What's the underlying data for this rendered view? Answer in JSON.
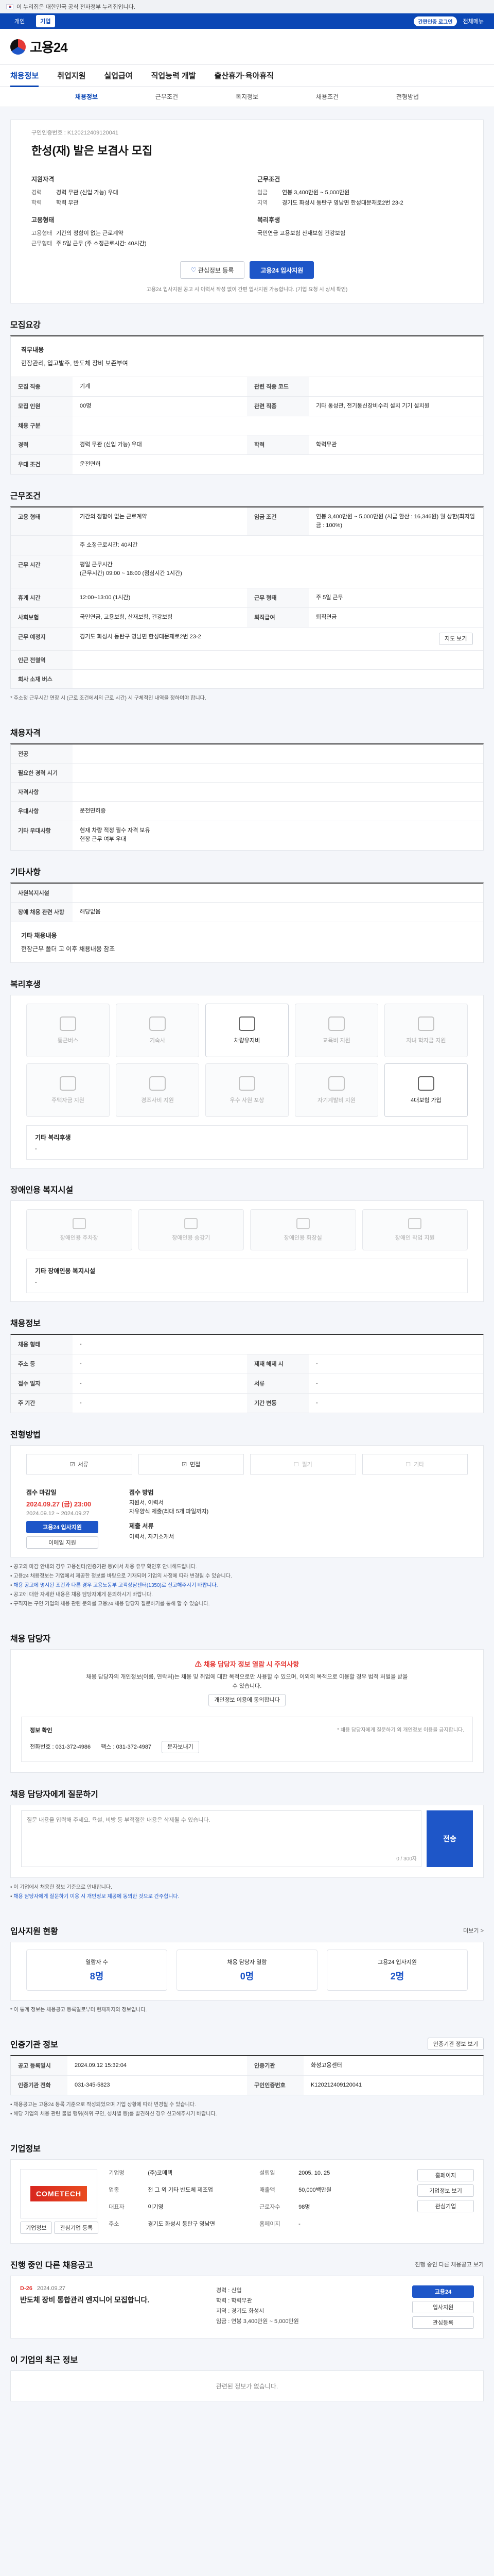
{
  "gov_bar": {
    "text": "이 누리집은 대한민국 공식 전자정부 누리집입니다."
  },
  "util": {
    "tabs": [
      "개인",
      "기업"
    ],
    "login_badge": "간편인증 로그인",
    "menu": "전체메뉴"
  },
  "logo": {
    "text": "고용24"
  },
  "gnb": [
    "채용정보",
    "취업지원",
    "실업급여",
    "직업능력 개발",
    "출산휴가·육아휴직"
  ],
  "subnav": [
    "채용정보",
    "근무조건",
    "복지정보",
    "채용조건",
    "전형방법"
  ],
  "hero": {
    "crumb": "구인인증번호 : K120212409120041",
    "title": "한성(재) 발은 보겸사 모집",
    "left_title": "지원자격",
    "left": [
      {
        "k": "경력",
        "v": "경력 무관 (신입 가능) 우대"
      },
      {
        "k": "학력",
        "v": "학력 무관"
      },
      {
        "k": "",
        "v": ""
      }
    ],
    "right_title": "근무조건",
    "right": [
      {
        "k": "임금",
        "v": "연봉 3,400만원 ~ 5,000만원"
      },
      {
        "k": "지역",
        "v": "경기도 화성시 동탄구 영남면 한성대문재로2번 23-2"
      }
    ],
    "left2_title": "고용형태",
    "left2": [
      {
        "k": "고용형태",
        "v": "기간의 정함이 없는 근로계약"
      },
      {
        "k": "근무형태",
        "v": "주 5일 근무 (주 소정근로시간: 40시간)"
      }
    ],
    "right2_title": "복리후생",
    "right2": [
      {
        "k": "",
        "v": "국민연금 고용보험 산재보험 건강보험"
      }
    ],
    "btn_save": "관심정보 등록",
    "btn_apply": "고용24 입사지원",
    "note": "고용24 입사지원 공고 시 이력서 작성 없이 간편 입사지원 가능합니다. (기업 요청 시 상세 확인)"
  },
  "sections": {
    "recruit": "모집요강",
    "work": "근무조건",
    "apply_cond": "채용자격",
    "other": "기타사항",
    "welfare": "복리후생",
    "disab": "장애인용 복지시설",
    "contract": "채용정보",
    "method": "전형방법",
    "manager": "채용 담당자",
    "inquiry": "채용 담당자에게 질문하기",
    "stats": "입사지원 현황",
    "agency": "인증기관 정보",
    "company": "기업정보",
    "other_jobs": "진행 중인 다른 채용공고",
    "recent": "이 기업의 최근 정보"
  },
  "recruit": {
    "job_title": "직무내용",
    "job_desc": "현장관리, 입고발주, 반도체 장비 보존부여",
    "rows": [
      {
        "k": "모집 직종",
        "v": "기계",
        "k2": "관련 직종 코드",
        "v2": ""
      },
      {
        "k": "모집 인원",
        "v": "00명",
        "k2": "관련 직종",
        "v2": "기타 통성관, 전기통신장비수리 설치 기기 설치원"
      },
      {
        "k": "채용 구분",
        "v": "",
        "k2": "",
        "v2": ""
      },
      {
        "k": "경력",
        "v": "경력 무관 (신입 가능) 우대",
        "k2": "학력",
        "v2": "학력무관"
      },
      {
        "k": "우대 조건",
        "v": "운전면허",
        "k2": "",
        "v2": ""
      }
    ]
  },
  "work": {
    "rows": [
      {
        "k": "고용 형태",
        "v": "기간의 정함이 없는 근로계약",
        "k2": "임금 조건",
        "v2": "연봉 3,400만원 ~ 5,000만원 (시급 환산 : 16,346원) 월 상한(최저임금 : 100%)"
      },
      {
        "k": "",
        "v": "주 소정근로시간: 40시간",
        "k2": "",
        "v2": ""
      },
      {
        "k": "근무 시간",
        "v": "평일 근무시간\n(근무시간) 09:00 ~ 18:00 (점심시간 1시간)",
        "k2": "",
        "v2": ""
      },
      {
        "k": "휴게 시간",
        "v": "12:00~13:00 (1시간)",
        "k2": "근무 형태",
        "v2": "주 5일 근무"
      },
      {
        "k": "사회보험",
        "v": "국민연금, 고용보험, 산재보험, 건강보험",
        "k2": "퇴직급여",
        "v2": "퇴직연금"
      },
      {
        "k": "근무 예정지",
        "v": "경기도 화성시 동탄구 영남면 한성대문재로2번 23-2",
        "k2": "",
        "v2": ""
      },
      {
        "k": "인근 전철역",
        "v": "",
        "k2": "",
        "v2": ""
      },
      {
        "k": "회사 소재 버스",
        "v": "",
        "k2": "",
        "v2": ""
      }
    ],
    "map_btn": "지도 보기",
    "note": "* 주소정 근무시간 연장 시 (근로 조건에서의 근로 시간) 시 구체적인 내역을 정하여야 합니다."
  },
  "apply_cond": {
    "rows": [
      {
        "k": "전공",
        "v": ""
      },
      {
        "k": "필요한 경력 시기",
        "v": ""
      },
      {
        "k": "자격사항",
        "v": ""
      },
      {
        "k": "우대사항",
        "v": "운전면허증"
      },
      {
        "k": "기타 우대사항",
        "v": "현재 차량 적정 필수 자격 보유\n현장 근무 여부 우대"
      }
    ]
  },
  "other": {
    "rows": [
      {
        "k": "사원복지시설",
        "v": ""
      },
      {
        "k": "장애 채용 관련 사항",
        "v": "해당없음"
      }
    ],
    "box_title": "기타 채용내용",
    "box_text": "현장근무 폴더 고 이후 채용내용 참조"
  },
  "welfare": {
    "cards": [
      {
        "label": "통근버스",
        "on": false
      },
      {
        "label": "기숙사",
        "on": false
      },
      {
        "label": "차량유지비",
        "on": true
      },
      {
        "label": "교육비 지원",
        "on": false
      },
      {
        "label": "자녀 학자금 지원",
        "on": false
      },
      {
        "label": "주택자금 지원",
        "on": false
      },
      {
        "label": "경조사비 지원",
        "on": false
      },
      {
        "label": "우수 사원 포상",
        "on": false
      },
      {
        "label": "자기계발비 지원",
        "on": false
      },
      {
        "label": "4대보험 가입",
        "on": true
      }
    ],
    "box_title": "기타 복리후생",
    "box_text": "-"
  },
  "disab": {
    "cards": [
      "장애인용 주차장",
      "장애인용 승강기",
      "장애인용 화장실",
      "장애인 작업 지원"
    ],
    "box_title": "기타 장애인용 복지시설",
    "box_text": "-"
  },
  "contract": {
    "rows": [
      {
        "k": "채용 형태",
        "v": "-",
        "k2": "",
        "v2": ""
      },
      {
        "k": "주소 등",
        "v": "-",
        "k2": "제재 해제 시",
        "v2": "-"
      },
      {
        "k": "접수 일자",
        "v": "-",
        "k2": "서류",
        "v2": "-"
      },
      {
        "k": "주 기간",
        "v": "-",
        "k2": "기간 변동",
        "v2": "-"
      }
    ]
  },
  "method": {
    "items": [
      {
        "label": "서류",
        "on": true
      },
      {
        "label": "면접",
        "on": true
      },
      {
        "label": "필기",
        "on": false
      },
      {
        "label": "기타",
        "on": false
      }
    ],
    "deadline_title": "접수 마감일",
    "deadline": "2024.09.27 (금) 23:00",
    "deadline_sub": "2024.09.12 ~ 2024.09.27",
    "apply_btn": "고용24 입사지원",
    "apply_btn2": "이메일 지원",
    "doc_title": "접수 방법",
    "doc_text": "지원서, 이력서\n자유양식 제출(최대 5개 파일까지)",
    "docs_title": "제출 서류",
    "docs_text": "이력서, 자기소개서"
  },
  "notices": [
    "공고의 마감 안내의 경우 고용센터(인증기관 등)에서 채용 유무 확인후 안내해드립니다.",
    "고용24 채용정보는 기업에서 제공한 정보를 바탕으로 기재되며 기업의 사정에 따라 변경될 수 있습니다.",
    "채용 공고에 명시된 조건과 다른 경우 고용노동부 고객상담센터(1350)로 신고해주시기 바랍니다.",
    "공고에 대한 자세한 내용은 채용 담당자에게 문의하시기 바랍니다.",
    "구직자는 구인 기업의 채용 관련 문의를 고용24 채용 담당자 질문하기를 통해 할 수 있습니다."
  ],
  "manager": {
    "alert_title": "채용 담당자 정보 열람 시 주의사항",
    "alert_text": "채용 담당자의 개인정보(이름, 연락처)는 채용 및 취업에 대한 목적으로만 사용할 수 있으며, 이외의 목적으로 이용할 경우 법적 처벌을 받을 수 있습니다.",
    "agree_btn": "개인정보 이용에 동의합니다",
    "info_title": "정보 확인",
    "info_sub": "* 채용 담당자에게 질문하기 외 개인정보 이용을 금지합니다.",
    "phone": "전화번호 : 031-372-4986",
    "fax": "팩스 : 031-372-4987",
    "sms_btn": "문자보내기"
  },
  "inquiry": {
    "placeholder": "질문 내용을 입력해 주세요. 욕설, 비방 등 부적절한 내용은 삭제될 수 있습니다.",
    "counter": "0 / 300자",
    "send": "전송",
    "notes": [
      "이 기업에서 채용한 정보 기준으로 안내합니다.",
      "채용 담당자에게 질문하기 이용 시 개인정보 제공에 동의한 것으로 간주합니다."
    ]
  },
  "stats": {
    "items": [
      {
        "label": "열람자 수",
        "num": "8명"
      },
      {
        "label": "채용 담당자 열람",
        "num": "0명"
      },
      {
        "label": "고용24 입사지원",
        "num": "2명"
      }
    ],
    "note": "* 이 통계 정보는 채용공고 등록일로부터 현재까지의 정보입니다.",
    "more": "더보기 >"
  },
  "agency": {
    "btn": "인증기관 정보 보기",
    "rows": [
      {
        "k": "공고 등록일시",
        "v": "2024.09.12 15:32:04",
        "k2": "인증기관",
        "v2": "화성고용센터"
      },
      {
        "k": "인증기관 전화",
        "v": "031-345-5823",
        "k2": "구인인증번호",
        "v2": "K120212409120041"
      }
    ],
    "notes": [
      "채용공고는 고용24 등록 기준으로 작성되었으며 기업 상황에 따라 변경될 수 있습니다.",
      "해당 기업의 채용 관련 불법 행위(허위 구인, 성차별 등)를 발견하신 경우 신고해주시기 바랍니다."
    ]
  },
  "company": {
    "logo": "COMETECH",
    "btns": [
      "기업정보",
      "관심기업 등록"
    ],
    "kv": [
      {
        "k": "기업명",
        "v": "(주)코메텍"
      },
      {
        "k": "설립일",
        "v": "2005. 10. 25"
      },
      {
        "k": "업종",
        "v": "전 그 외 기타 반도체 제조업"
      },
      {
        "k": "매출액",
        "v": "50,000백만원"
      },
      {
        "k": "대표자",
        "v": "이기영"
      },
      {
        "k": "근로자수",
        "v": "98명"
      },
      {
        "k": "주소",
        "v": "경기도 화성시 동탄구 영남면"
      },
      {
        "k": "홈페이지",
        "v": "-"
      }
    ],
    "side": [
      "홈페이지",
      "기업정보 보기",
      "관심기업"
    ]
  },
  "other_jobs": {
    "more": "진행 중인 다른 채용공고 보기",
    "dday": "D-26",
    "date": "2024.09.27",
    "title": "반도체 장비 통합관리 엔지니어 모집합니다.",
    "items": [
      "경력 : 신입",
      "학력 : 학력무관",
      "지역 : 경기도 화성시",
      "임금 : 연봉 3,400만원 ~ 5,000만원"
    ],
    "btns": [
      "고용24",
      "입사지원",
      "관심등록"
    ]
  },
  "recent": {
    "text": "관련된 정보가 없습니다."
  }
}
